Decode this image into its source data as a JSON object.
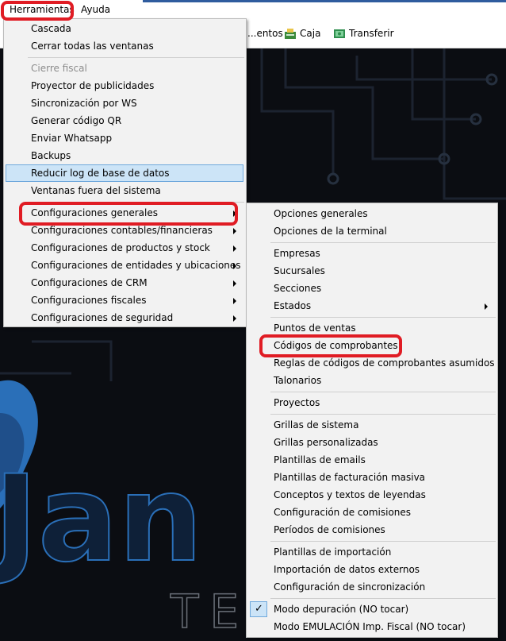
{
  "menubar": {
    "items": [
      "Herramientas",
      "Ayuda"
    ]
  },
  "toolbar": {
    "items": [
      {
        "label": "...entos",
        "icon": "document-icon"
      },
      {
        "label": "Caja",
        "icon": "cash-register-icon"
      },
      {
        "label": "Transferir",
        "icon": "transfer-icon"
      }
    ]
  },
  "herramientas_menu": {
    "items": [
      "Cascada",
      "Cerrar todas las ventanas",
      "Cierre fiscal",
      "Proyector de publicidades",
      "Sincronización por WS",
      "Generar código QR",
      "Enviar Whatsapp",
      "Backups",
      "Reducir log de base de datos",
      "Ventanas fuera del sistema",
      "Configuraciones generales",
      "Configuraciones contables/financieras",
      "Configuraciones de productos y stock",
      "Configuraciones de entidades y ubicaciones",
      "Configuraciones de CRM",
      "Configuraciones fiscales",
      "Configuraciones de seguridad"
    ],
    "disabled_item": "Cierre fiscal",
    "highlighted_item": "Reducir log de base de datos"
  },
  "config_generales_submenu": {
    "items": [
      "Opciones generales",
      "Opciones de la terminal",
      "Empresas",
      "Sucursales",
      "Secciones",
      "Estados",
      "Puntos de ventas",
      "Códigos de comprobantes",
      "Reglas de códigos de comprobantes asumidos",
      "Talonarios",
      "Proyectos",
      "Grillas de sistema",
      "Grillas personalizadas",
      "Plantillas de emails",
      "Plantillas de facturación masiva",
      "Conceptos y textos de leyendas",
      "Configuración de comisiones",
      "Períodos de comisiones",
      "Plantillas de importación",
      "Importación de datos externos",
      "Configuración de sincronización",
      "Modo depuración (NO tocar)",
      "Modo EMULACIÓN Imp. Fiscal (NO tocar)"
    ],
    "checked_item": "Modo depuración (NO tocar)"
  },
  "background": {
    "logo_text": "Jan",
    "sub_text": "TEC"
  },
  "colors": {
    "highlight": "#cce4f7",
    "annotation": "#e01c24",
    "logo": "#2a6fb8"
  }
}
